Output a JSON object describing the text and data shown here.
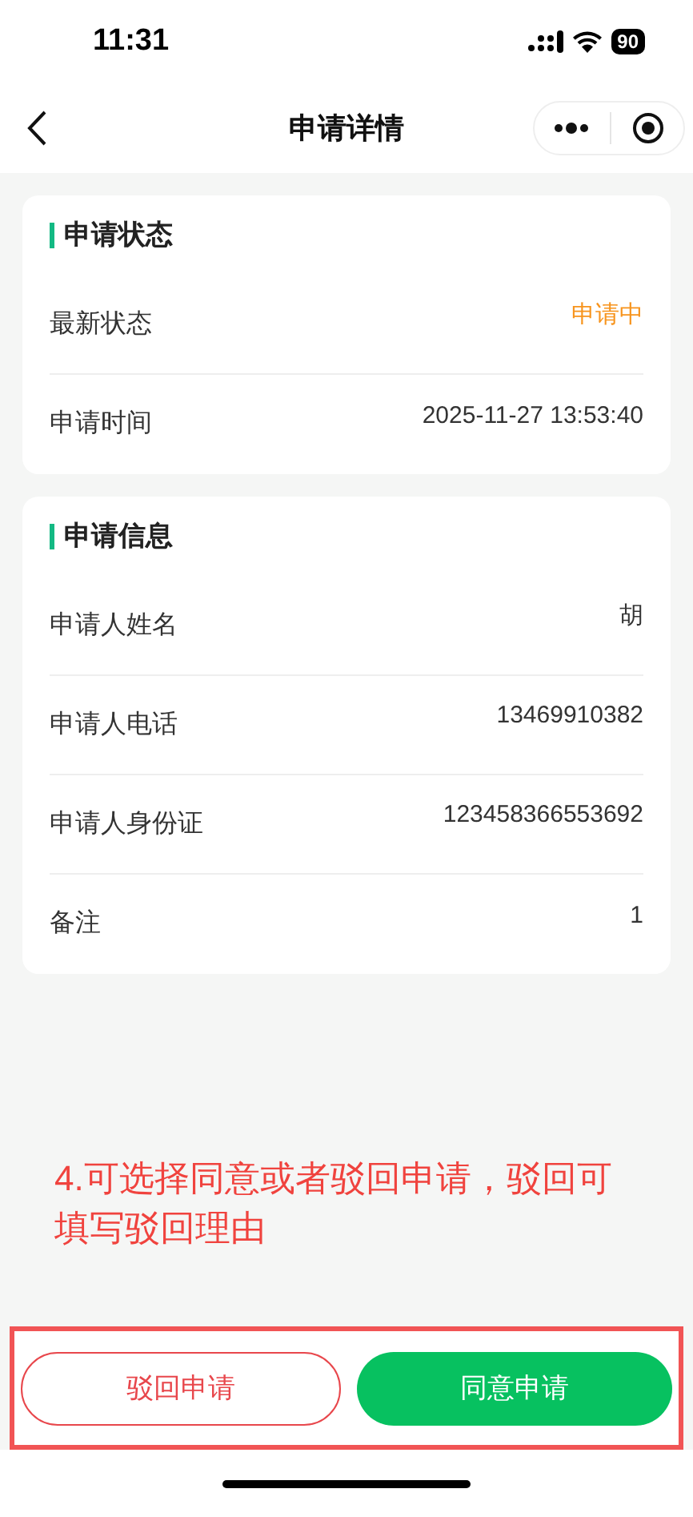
{
  "status_bar": {
    "time": "11:31",
    "battery": "90"
  },
  "nav": {
    "title": "申请详情"
  },
  "sections": [
    {
      "title": "申请状态",
      "rows": [
        {
          "label": "最新状态",
          "value": "申请中",
          "kind": "status"
        },
        {
          "label": "申请时间",
          "value": "2025-11-27 13:53:40",
          "kind": "text"
        }
      ]
    },
    {
      "title": "申请信息",
      "rows": [
        {
          "label": "申请人姓名",
          "value": "胡",
          "kind": "text"
        },
        {
          "label": "申请人电话",
          "value": "13469910382",
          "kind": "text"
        },
        {
          "label": "申请人身份证",
          "value": "123458366553692",
          "kind": "text"
        },
        {
          "label": "备注",
          "value": "1",
          "kind": "text"
        }
      ]
    }
  ],
  "annotation": "4.可选择同意或者驳回申请，驳回可填写驳回理由",
  "buttons": [
    {
      "label": "驳回申请",
      "kind": "outline"
    },
    {
      "label": "同意申请",
      "kind": "primary"
    }
  ]
}
